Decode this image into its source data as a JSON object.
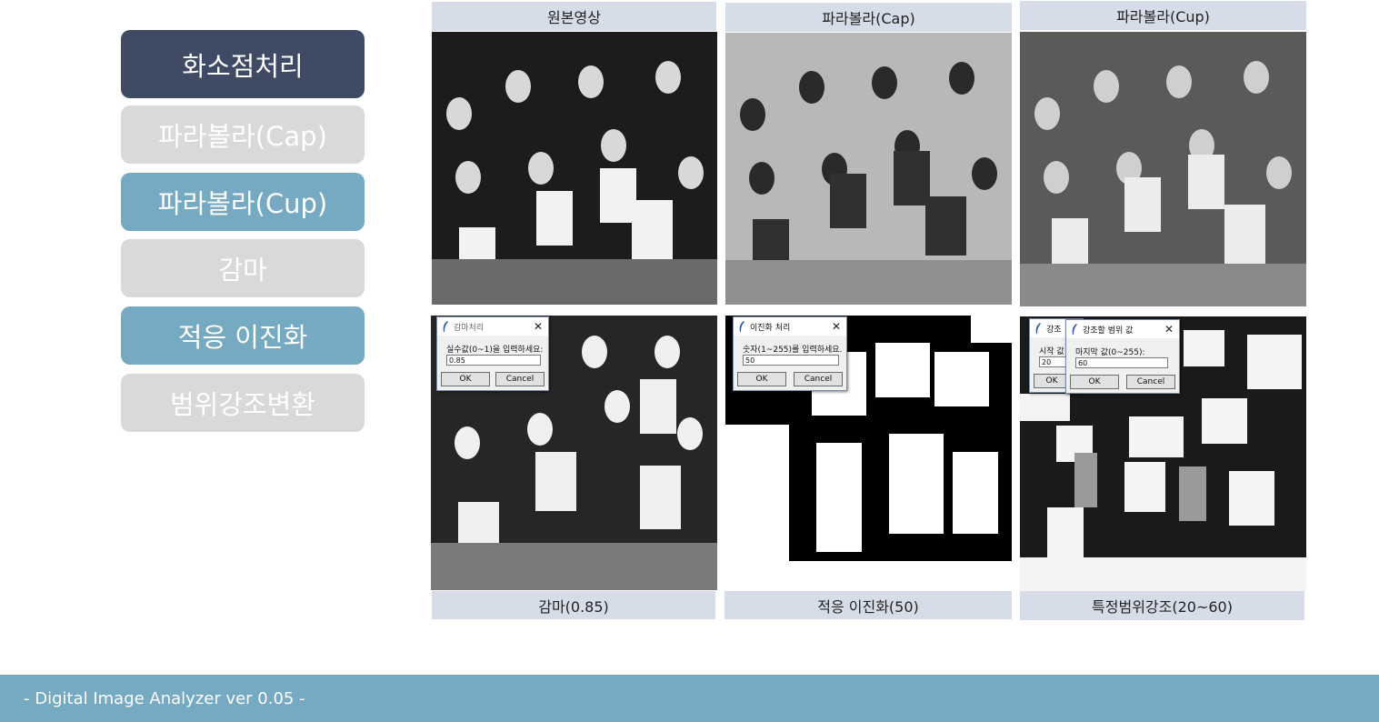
{
  "sidebar": {
    "items": [
      {
        "label": "화소점처리"
      },
      {
        "label": "파라볼라(Cap)"
      },
      {
        "label": "파라볼라(Cup)"
      },
      {
        "label": "감마"
      },
      {
        "label": "적응 이진화"
      },
      {
        "label": "범위강조변환"
      }
    ]
  },
  "panels": {
    "top": [
      {
        "caption": "원본영상"
      },
      {
        "caption": "파라볼라(Cap)"
      },
      {
        "caption": "파라볼라(Cup)"
      }
    ],
    "bottom": [
      {
        "caption": "감마(0.85)"
      },
      {
        "caption": "적응 이진화(50)"
      },
      {
        "caption": "특정범위강조(20~60)"
      }
    ]
  },
  "dialogs": {
    "gamma": {
      "title": "감마처리",
      "prompt": "실수값(0~1)을 입력하세요:",
      "value": "0.85",
      "ok": "OK",
      "cancel": "Cancel"
    },
    "binarize": {
      "title": "이진화 처리",
      "prompt": "숫자(1~255)를 입력하세요.",
      "value": "50",
      "ok": "OK",
      "cancel": "Cancel"
    },
    "range_start": {
      "title": "강조",
      "prompt": "시작 값",
      "value": "20",
      "ok": "OK"
    },
    "range_end": {
      "title": "강조할 범위 값",
      "prompt": "마지막 값(0~255):",
      "value": "60",
      "ok": "OK",
      "cancel": "Cancel"
    }
  },
  "footer": {
    "text": "- Digital Image Analyzer ver 0.05 -"
  },
  "colors": {
    "dark_button": "#3f4a64",
    "blue_button": "#76a9c2",
    "gray_button": "#d9d9d9",
    "caption_bg": "#d6dde8",
    "footer_bg": "#76a9c2"
  }
}
